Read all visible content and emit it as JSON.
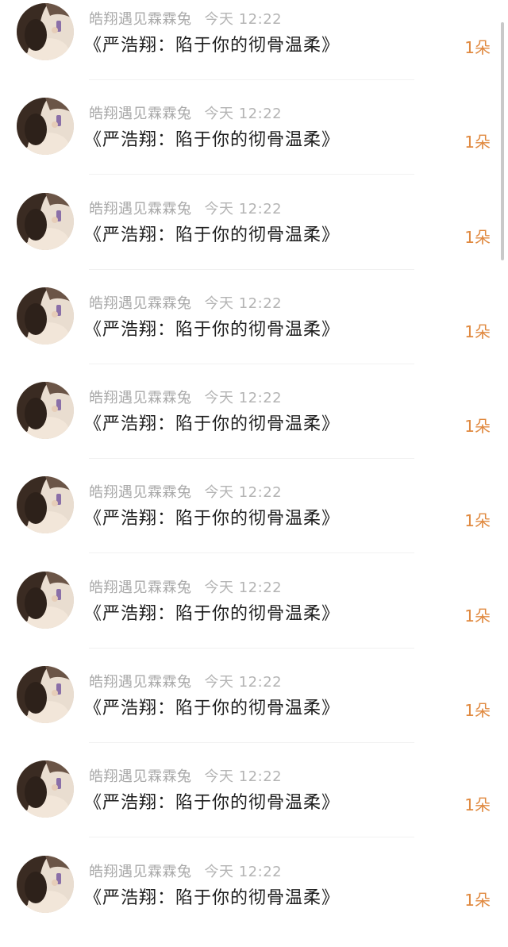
{
  "messages": [
    {
      "sender": "皓翔遇见霖霖兔",
      "time": "今天 12:22",
      "content": "《严浩翔：陷于你的彻骨温柔》",
      "gift": "1朵"
    },
    {
      "sender": "皓翔遇见霖霖兔",
      "time": "今天 12:22",
      "content": "《严浩翔：陷于你的彻骨温柔》",
      "gift": "1朵"
    },
    {
      "sender": "皓翔遇见霖霖兔",
      "time": "今天 12:22",
      "content": "《严浩翔：陷于你的彻骨温柔》",
      "gift": "1朵"
    },
    {
      "sender": "皓翔遇见霖霖兔",
      "time": "今天 12:22",
      "content": "《严浩翔：陷于你的彻骨温柔》",
      "gift": "1朵"
    },
    {
      "sender": "皓翔遇见霖霖兔",
      "time": "今天 12:22",
      "content": "《严浩翔：陷于你的彻骨温柔》",
      "gift": "1朵"
    },
    {
      "sender": "皓翔遇见霖霖兔",
      "time": "今天 12:22",
      "content": "《严浩翔：陷于你的彻骨温柔》",
      "gift": "1朵"
    },
    {
      "sender": "皓翔遇见霖霖兔",
      "time": "今天 12:22",
      "content": "《严浩翔：陷于你的彻骨温柔》",
      "gift": "1朵"
    },
    {
      "sender": "皓翔遇见霖霖兔",
      "time": "今天 12:22",
      "content": "《严浩翔：陷于你的彻骨温柔》",
      "gift": "1朵"
    },
    {
      "sender": "皓翔遇见霖霖兔",
      "time": "今天 12:22",
      "content": "《严浩翔：陷于你的彻骨温柔》",
      "gift": "1朵"
    },
    {
      "sender": "皓翔遇见霖霖兔",
      "time": "今天 12:22",
      "content": "《严浩翔：陷于你的彻骨温柔》",
      "gift": "1朵"
    }
  ],
  "colors": {
    "sender": "#a9a9a9",
    "time": "#b4b4b4",
    "content": "#1e1e1e",
    "gift": "#e0893f",
    "divider": "#f1f1f1"
  },
  "icons": {
    "avatar": "user-photo-avatar"
  }
}
